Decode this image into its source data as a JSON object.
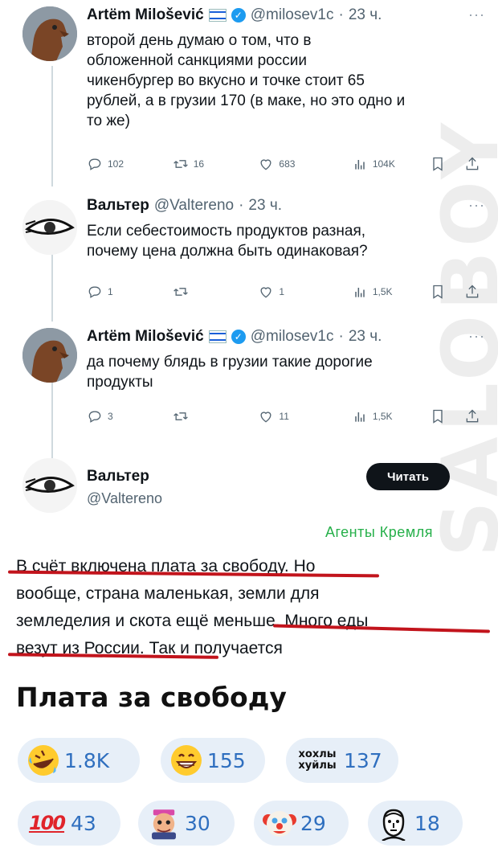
{
  "watermark": "SALOBOY",
  "tweets": [
    {
      "name": "Artëm Milošević",
      "handle": "@milosev1c",
      "dot": "·",
      "time": "23 ч.",
      "text_lines": [
        "второй день думаю о том, что в",
        "обложенной санкциями россии",
        "чикенбургер во вкусно и точке стоит 65",
        "рублей, а в грузии 170 (в маке, но это одно и",
        "то же)"
      ],
      "actions": {
        "replies": "102",
        "retweets": "16",
        "likes": "683",
        "views": "104K"
      }
    },
    {
      "name": "Вальтер",
      "handle": "@Valtereno",
      "dot": "·",
      "time": "23 ч.",
      "text_lines": [
        "Если себестоимость продуктов разная,",
        "почему цена должна быть одинаковая?"
      ],
      "actions": {
        "replies": "1",
        "retweets": "",
        "likes": "1",
        "views": "1,5K"
      }
    },
    {
      "name": "Artëm Milošević",
      "handle": "@milosev1c",
      "dot": "·",
      "time": "23 ч.",
      "text_lines": [
        "да почему блядь в грузии такие дорогие",
        "продукты"
      ],
      "actions": {
        "replies": "3",
        "retweets": "",
        "likes": "11",
        "views": "1,5K"
      }
    }
  ],
  "main_tweet": {
    "name": "Вальтер",
    "handle": "@Valtereno",
    "follow_label": "Читать",
    "annotation": "Агенты Кремля",
    "text_lines": [
      "В счёт включена плата за свободу. Но",
      "вообще, страна маленькая, земли для",
      "земледелия и скота ещё меньше. Много еды",
      "везут из России. Так и получается"
    ]
  },
  "post": {
    "title": "Плата за свободу"
  },
  "reactions": [
    {
      "emoji": "rofl-icon",
      "count": "1.8K"
    },
    {
      "emoji": "grin-icon",
      "count": "155"
    },
    {
      "emoji_text": "хохлы хуйлы",
      "count": "137"
    },
    {
      "emoji": "hundred-icon",
      "emoji_text": "100",
      "count": "43"
    },
    {
      "emoji": "sticker-man-icon",
      "count": "30"
    },
    {
      "emoji": "clown-icon",
      "count": "29"
    },
    {
      "emoji": "portrait-icon",
      "count": "18"
    }
  ],
  "colors": {
    "accent_blue": "#1d9bf0",
    "underline_red": "#c2141c",
    "annotation_green": "#26b04a",
    "reaction_bg": "#e7eff8",
    "reaction_count": "#2f6fbf"
  }
}
